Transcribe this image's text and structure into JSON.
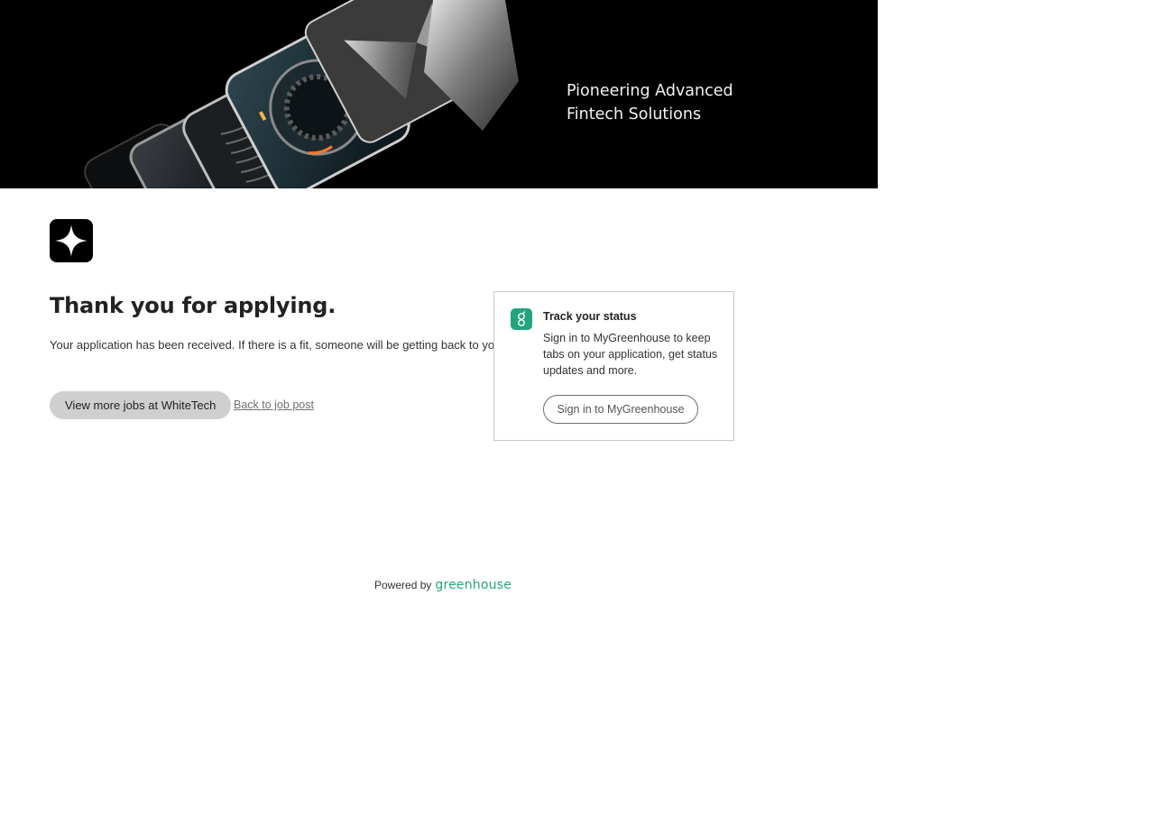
{
  "banner": {
    "tagline": "Pioneering Advanced\nFintech Solutions"
  },
  "confirmation": {
    "title": "Thank you for applying.",
    "message": "Your application has been received. If there is a fit, someone will be getting back to you.",
    "more_jobs_label": "View more jobs at WhiteTech",
    "back_link_label": "Back to job post"
  },
  "track_status": {
    "title": "Track your status",
    "body": "Sign in to MyGreenhouse to keep tabs on your application, get status updates and more.",
    "signin_label": "Sign in to MyGreenhouse",
    "badge_glyph": "g"
  },
  "footer": {
    "powered_by": "Powered by",
    "brand": "greenhouse"
  },
  "colors": {
    "brand_green": "#23a47f",
    "banner_bg": "#000000",
    "button_gray": "#cfcfcf"
  },
  "icons": {
    "company_logo": "four-point-star-icon",
    "greenhouse_badge": "greenhouse-g-icon"
  }
}
